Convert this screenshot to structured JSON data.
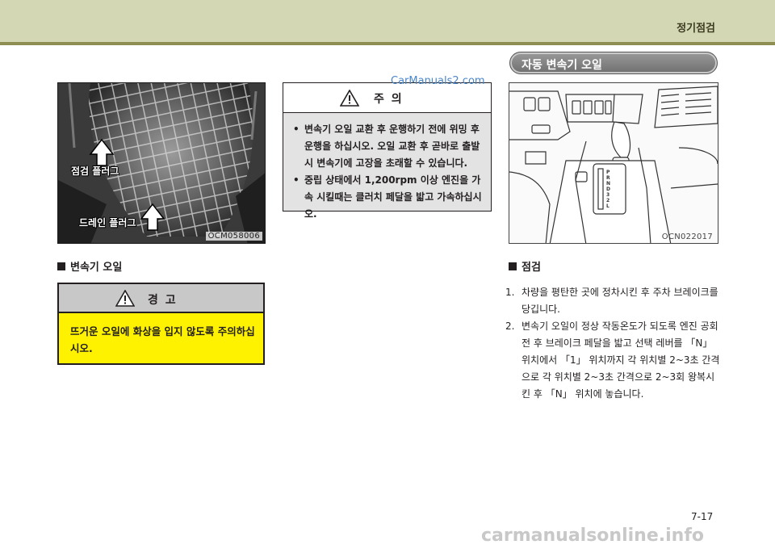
{
  "header": {
    "section_title": "정기점검"
  },
  "watermark_top": "CarManuals2.com",
  "photo": {
    "code": "OCM058006",
    "label_check_plug": "점검 플러그",
    "label_drain_plug": "드레인 플러그"
  },
  "left_caption": "변속기 오일",
  "warning": {
    "title": "경  고",
    "text": "뜨거운 오일에 화상을 입지 않도록 주의하십시오."
  },
  "caution": {
    "title": "주  의",
    "bullets": [
      "변속기 오일 교환 후 운행하기 전에 위밍 후 운행을 하십시오. 오일 교환 후 곧바로 출발시 변속기에 고장을 초래할 수 있습니다.",
      "중립 상태에서 1,200rpm 이상 엔진을 가속 시킬때는 클러치 페달을 밟고 가속하십시오."
    ]
  },
  "right_section_title": "자동 변속기 오일",
  "diagram": {
    "code": "OCN022017",
    "gear_letters": [
      "P",
      "R",
      "N",
      "D",
      "3",
      "2",
      "L"
    ]
  },
  "inspection_caption": "점검",
  "steps": [
    {
      "num": "1.",
      "text": "차량을 평탄한 곳에 정차시킨 후 주차 브레이크를 당깁니다."
    },
    {
      "num": "2.",
      "text": "변속기 오일이 정상 작동온도가 되도록 엔진 공회전 후 브레이크 페달을 밟고 선택 레버를 「N」 위치에서 「1」 위치까지 각 위치별 2~3초 간격으로 각 위치별 2~3초 간격으로 2~3회 왕복시킨 후 「N」 위치에 놓습니다."
    }
  ],
  "page_number": "7-17",
  "footer_watermark": "carmanualsonline.info"
}
